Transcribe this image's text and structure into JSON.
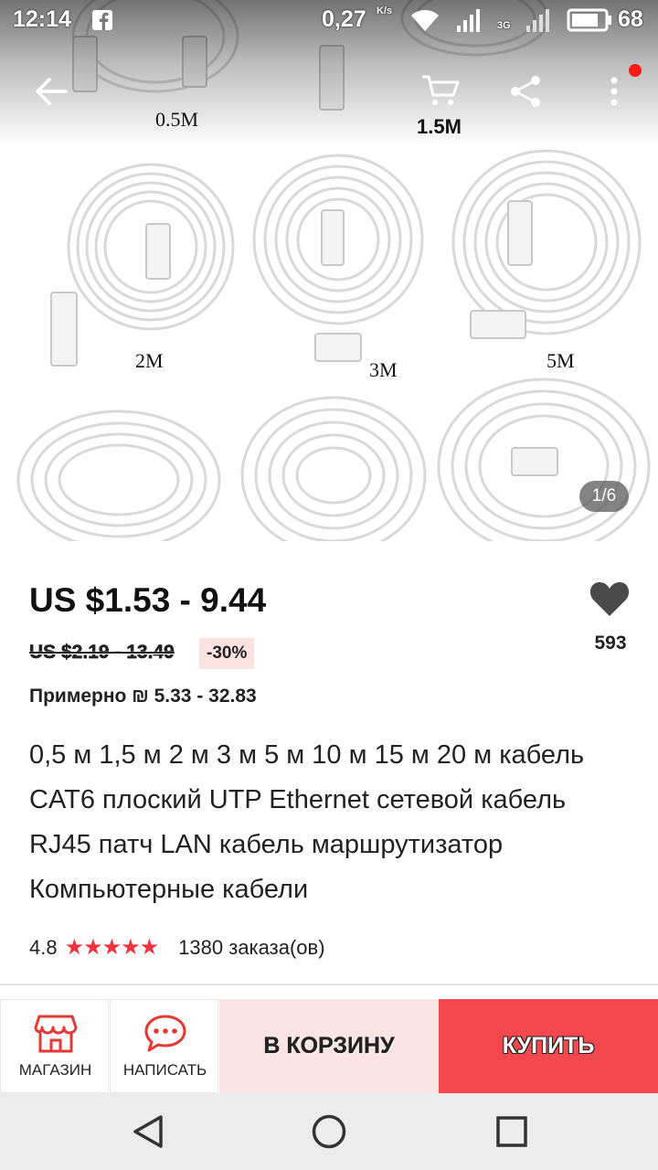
{
  "status_bar": {
    "time": "12:14",
    "speed": "0,27",
    "speed_unit": "K/s",
    "network": "3G",
    "battery": "68"
  },
  "gallery": {
    "size_labels": [
      "0.5M",
      "1.5M",
      "2M",
      "3M",
      "5M"
    ],
    "page_indicator": "1/6"
  },
  "product": {
    "price": "US $1.53 - 9.44",
    "old_price": "US $2.19 - 13.49",
    "discount": "-30%",
    "approx_price": "Примерно ₪ 5.33 - 32.83",
    "wishlist_count": "593",
    "title": "0,5 м 1,5 м 2 м 3 м 5 м 10 м 15 м 20 м кабель CAT6 плоский UTP Ethernet сетевой кабель RJ45 патч LAN кабель маршрутизатор Компьютерные кабели",
    "rating": "4.8",
    "stars": "★★★★★",
    "orders": "1380 заказа(ов)"
  },
  "actions": {
    "store_label": "МАГАЗИН",
    "message_label": "НАПИСАТЬ",
    "cart_label": "В КОРЗИНУ",
    "buy_label": "КУПИТЬ"
  },
  "colors": {
    "accent": "#f5474e",
    "cart_bg": "#fde4e4",
    "star": "#f2323c",
    "icon_red": "#e53935"
  }
}
